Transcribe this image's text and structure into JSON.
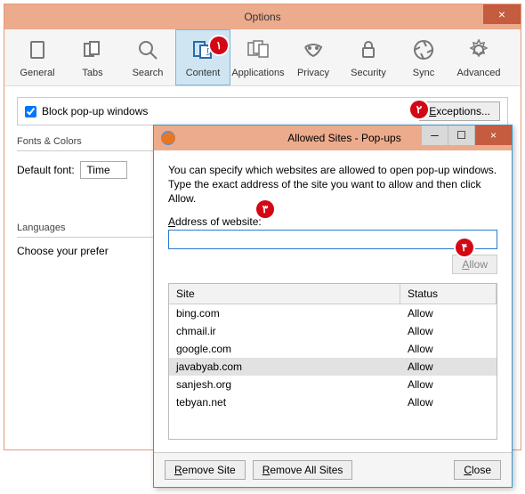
{
  "options": {
    "title": "Options",
    "tabs": [
      {
        "label": "General"
      },
      {
        "label": "Tabs"
      },
      {
        "label": "Search"
      },
      {
        "label": "Content"
      },
      {
        "label": "Applications"
      },
      {
        "label": "Privacy"
      },
      {
        "label": "Security"
      },
      {
        "label": "Sync"
      },
      {
        "label": "Advanced"
      }
    ],
    "block_popup": "Block pop-up windows",
    "exceptions": "Exceptions...",
    "fonts_colors": "Fonts & Colors",
    "default_font": "Default font:",
    "font_value": "Time",
    "languages": "Languages",
    "choose": "Choose your prefer"
  },
  "popup": {
    "title": "Allowed Sites - Pop-ups",
    "desc": "You can specify which websites are allowed to open pop-up windows. Type the exact address of the site you want to allow and then click Allow.",
    "addr_label_pre": "A",
    "addr_label_rest": "ddress of website:",
    "input_value": "",
    "allow_pre": "A",
    "allow_rest": "llow",
    "col_site": "Site",
    "col_status": "Status",
    "rows": [
      {
        "site": "bing.com",
        "status": "Allow",
        "sel": false
      },
      {
        "site": "chmail.ir",
        "status": "Allow",
        "sel": false
      },
      {
        "site": "google.com",
        "status": "Allow",
        "sel": false
      },
      {
        "site": "javabyab.com",
        "status": "Allow",
        "sel": true
      },
      {
        "site": "sanjesh.org",
        "status": "Allow",
        "sel": false
      },
      {
        "site": "tebyan.net",
        "status": "Allow",
        "sel": false
      }
    ],
    "remove_site_pre": "R",
    "remove_site_rest": "emove Site",
    "remove_all_pre": "R",
    "remove_all_rest": "emove All Sites",
    "close_pre": "C",
    "close_rest": "lose"
  },
  "badges": [
    "۱",
    "۲",
    "۳",
    "۴"
  ]
}
